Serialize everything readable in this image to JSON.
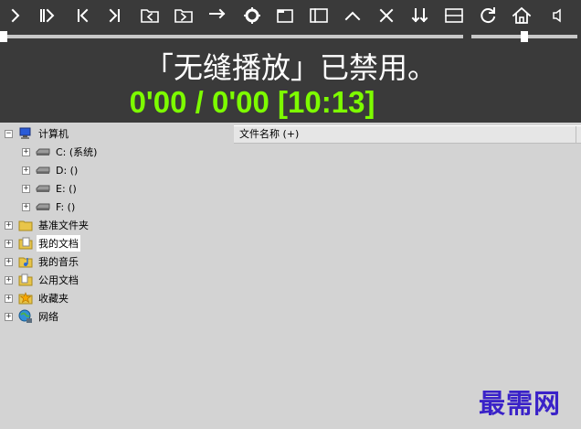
{
  "toolbar": {
    "icons": [
      "play-icon",
      "play-pause-icon",
      "previous-icon",
      "next-icon",
      "folder-back-icon",
      "folder-forward-icon",
      "arrow-right-icon",
      "gear-icon",
      "window-icon",
      "sidebar-icon",
      "chevron-up-icon",
      "close-icon",
      "sort-down-icon",
      "split-icon",
      "refresh-icon",
      "home-icon",
      "volume-icon"
    ]
  },
  "player": {
    "message": "「无缝播放」已禁用。",
    "time": "0'00 / 0'00   [10:13]",
    "seek_progress": 0.0,
    "volume_level": 0.5,
    "time_color": "#7dfc00"
  },
  "tree": {
    "items": [
      {
        "label": "计算机",
        "expander": "−",
        "icon": "computer-icon"
      },
      {
        "label": "C: (系统)",
        "expander": "+",
        "icon": "drive-icon"
      },
      {
        "label": "D: ()",
        "expander": "+",
        "icon": "drive-icon"
      },
      {
        "label": "E: ()",
        "expander": "+",
        "icon": "drive-icon"
      },
      {
        "label": "F: ()",
        "expander": "+",
        "icon": "drive-icon"
      },
      {
        "label": "基准文件夹",
        "expander": "+",
        "icon": "folder-icon"
      },
      {
        "label": "我的文档",
        "expander": "+",
        "icon": "documents-folder-icon"
      },
      {
        "label": "我的音乐",
        "expander": "+",
        "icon": "music-folder-icon"
      },
      {
        "label": "公用文档",
        "expander": "+",
        "icon": "public-folder-icon"
      },
      {
        "label": "收藏夹",
        "expander": "+",
        "icon": "favorites-icon"
      },
      {
        "label": "网络",
        "expander": "+",
        "icon": "network-icon"
      }
    ]
  },
  "list": {
    "columns": [
      "文件名称 (+)"
    ]
  },
  "watermark": "最需网"
}
